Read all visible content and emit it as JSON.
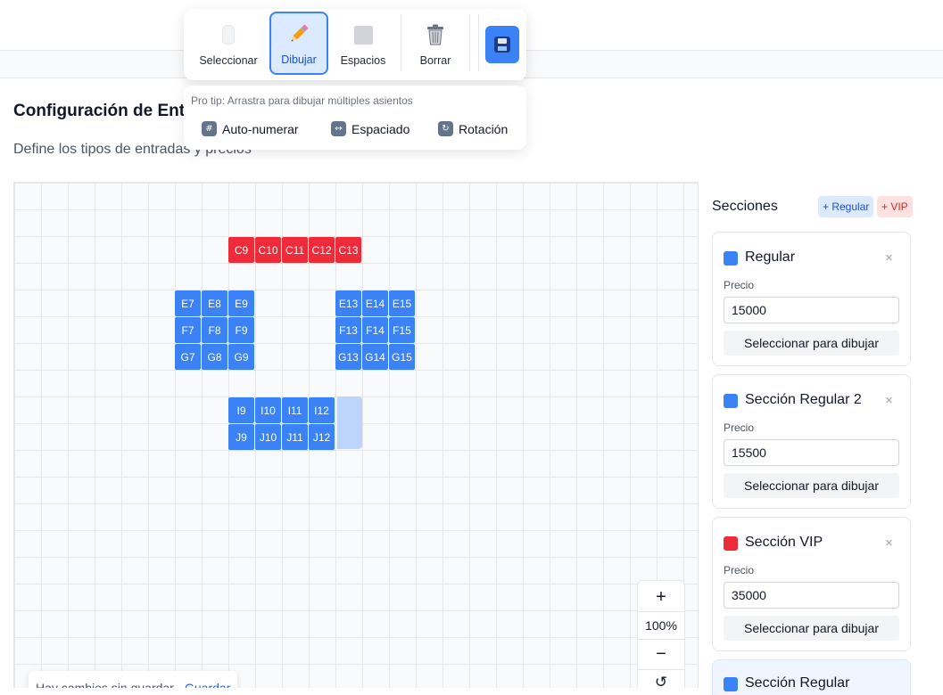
{
  "page": {
    "title": "Configuración de Ent",
    "subtitle": "Define los tipos de entradas y precios"
  },
  "toolbar": {
    "tools": [
      {
        "label": "Seleccionar",
        "icon": "mouse-icon"
      },
      {
        "label": "Dibujar",
        "icon": "pencil-icon",
        "active": true
      },
      {
        "label": "Espacios",
        "icon": "square-icon"
      },
      {
        "label": "Borrar",
        "icon": "trash-icon"
      }
    ],
    "save_icon": "floppy-disk-icon"
  },
  "tips": {
    "text": "Pro tip: Arrastra para dibujar múltiples asientos",
    "actions": [
      {
        "label": "Auto-numerar",
        "icon": "numbers-icon"
      },
      {
        "label": "Espaciado",
        "icon": "left-right-arrow-icon"
      },
      {
        "label": "Rotación",
        "icon": "rotate-icon"
      }
    ]
  },
  "seats": {
    "vip": [
      "C9",
      "C10",
      "C11",
      "C12",
      "C13"
    ],
    "left_block": [
      [
        "E7",
        "E8",
        "E9"
      ],
      [
        "F7",
        "F8",
        "F9"
      ],
      [
        "G7",
        "G8",
        "G9"
      ]
    ],
    "right_block": [
      [
        "E13",
        "E14",
        "E15"
      ],
      [
        "F13",
        "F14",
        "F15"
      ],
      [
        "G13",
        "G14",
        "G15"
      ]
    ],
    "bottom_block": [
      [
        "I9",
        "I10",
        "I11",
        "I12"
      ],
      [
        "J9",
        "J10",
        "J11",
        "J12"
      ]
    ]
  },
  "zoom": {
    "plus": "+",
    "level": "100%",
    "minus": "−",
    "reset": "↺"
  },
  "unsaved": {
    "message": "Hay cambios sin guardar",
    "action": "Guardar"
  },
  "sidebar": {
    "title": "Secciones",
    "add_regular": "+ Regular",
    "add_vip": "+ VIP",
    "price_label": "Precio",
    "select_label": "Seleccionar para dibujar",
    "close_glyph": "×",
    "sections": [
      {
        "name": "Regular",
        "price": "15000",
        "color": "#3b82f6"
      },
      {
        "name": "Sección Regular 2",
        "price": "15500",
        "color": "#3b82f6"
      },
      {
        "name": "Sección VIP",
        "price": "35000",
        "color": "#ef2b3a"
      },
      {
        "name": "Sección Regular",
        "color": "#3b82f6"
      }
    ]
  },
  "colors": {
    "regular": "#3b82f6",
    "vip": "#ef2b3a",
    "accent": "#3b82f6"
  }
}
